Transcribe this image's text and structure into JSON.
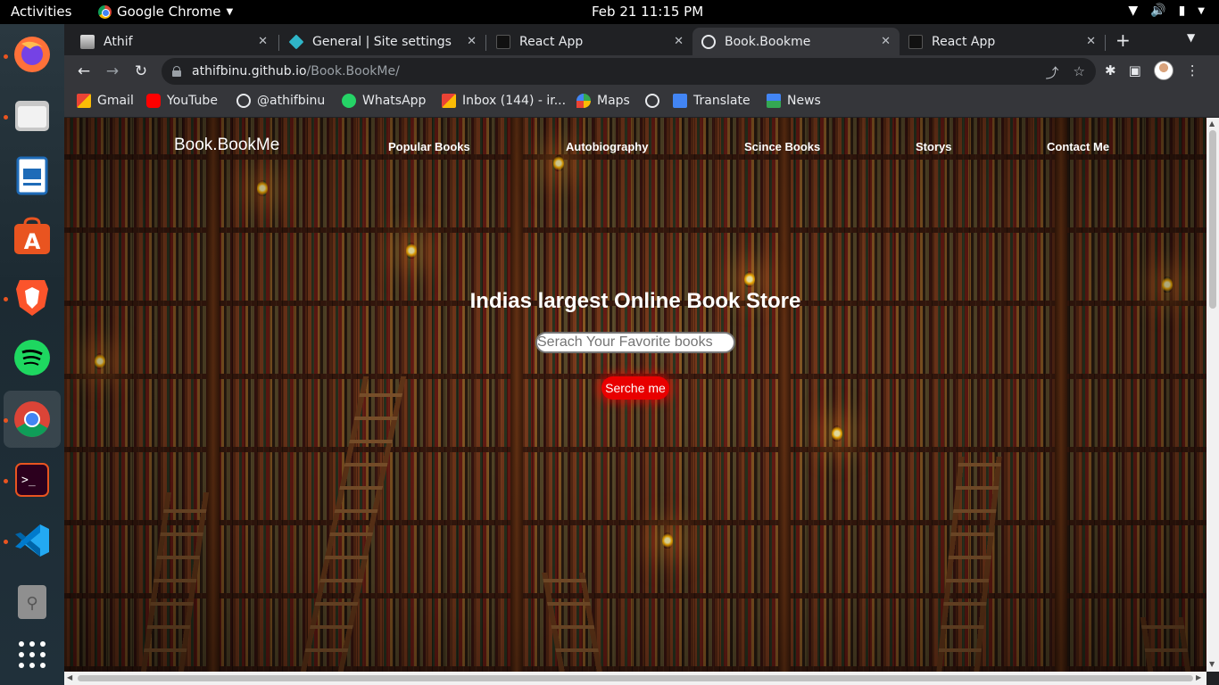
{
  "topbar": {
    "activities": "Activities",
    "app_name": "Google Chrome",
    "clock": "Feb 21  11:15 PM"
  },
  "dock": {
    "apps": [
      "firefox-icon",
      "files-icon",
      "libreoffice-impress-icon",
      "app-center-icon",
      "brave-icon",
      "spotify-icon",
      "chrome-icon",
      "terminal-icon",
      "vscode-icon",
      "usb-drive-icon",
      "show-apps-icon"
    ]
  },
  "tabs": [
    {
      "title": "Athif",
      "favicon": "profile-photo-icon"
    },
    {
      "title": "General | Site settings",
      "favicon": "diamond-icon"
    },
    {
      "title": "React App",
      "favicon": "react-app-icon"
    },
    {
      "title": "Book.Bookme",
      "favicon": "globe-icon",
      "active": true
    },
    {
      "title": "React App",
      "favicon": "react-app-icon"
    }
  ],
  "address_bar": {
    "host": "athifbinu.github.io",
    "path": "/Book.BookMe/"
  },
  "bookmarks": [
    {
      "label": "Gmail",
      "icon": "gmail-icon"
    },
    {
      "label": "YouTube",
      "icon": "youtube-icon"
    },
    {
      "label": "@athifbinu",
      "icon": "globe-icon"
    },
    {
      "label": "WhatsApp",
      "icon": "whatsapp-icon"
    },
    {
      "label": "Inbox (144) - ir...",
      "icon": "gmail-icon"
    },
    {
      "label": "Maps",
      "icon": "maps-icon"
    },
    {
      "label": "",
      "icon": "globe-icon"
    },
    {
      "label": "Translate",
      "icon": "translate-icon"
    },
    {
      "label": "News",
      "icon": "news-icon"
    }
  ],
  "site": {
    "logo": "Book.BookMe",
    "nav": [
      "Popular Books",
      "Autobiography",
      "Scince Books",
      "Storys",
      "Contact Me"
    ],
    "hero_title": "Indias largest Online Book Store",
    "search_placeholder": "Serach Your Favorite books",
    "search_button": "Serche me"
  },
  "colors": {
    "accent_button": "#e80000",
    "browser_dark": "#202124",
    "browser_toolbar": "#35363a"
  }
}
